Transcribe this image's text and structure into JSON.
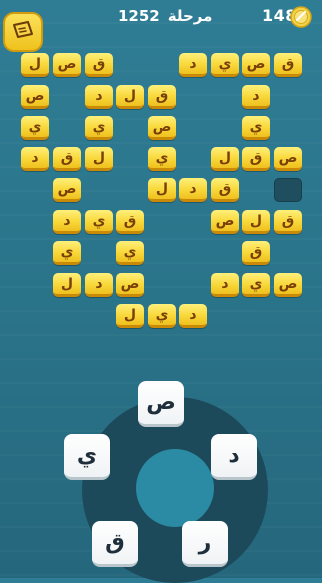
{
  "header": {
    "coins": "148",
    "level_label": "مرحلة",
    "level_number": "1252"
  },
  "icons": {
    "hint": "hint-ticket-icon",
    "coin": "coin-icon"
  },
  "colors": {
    "background": "#2a7389",
    "tile": "#f8d83a",
    "tile_text": "#7a3f08",
    "wheel_ring": "#1d4a5a",
    "wheel_center": "#2b8aa4",
    "key_bg": "#ffffff"
  },
  "board": {
    "rows": [
      [
        "ق",
        "ص",
        "ي",
        "د",
        "",
        "",
        "ق",
        "ص",
        "ل"
      ],
      [
        "د",
        "",
        "",
        "",
        "ق",
        "ل",
        "د",
        "",
        "ص"
      ],
      [
        "ي",
        "",
        "",
        "",
        "ص",
        "",
        "ي",
        "",
        "ي"
      ],
      [
        "ص",
        "ق",
        "ل",
        "",
        "ي",
        "",
        "ل",
        "ق",
        "د"
      ],
      [
        "",
        "",
        "ق",
        "د",
        "ل",
        "",
        "ص",
        "",
        ""
      ],
      [
        "ق",
        "ل",
        "ص",
        "",
        "",
        "ق",
        "ي",
        "د",
        ""
      ],
      [
        "",
        "ق",
        "",
        "",
        "ي",
        "",
        "",
        "ي",
        ""
      ],
      [
        "ص",
        "ي",
        "د",
        "",
        "ص",
        "د",
        "ل",
        "",
        ""
      ],
      [
        "",
        "",
        "",
        "د",
        "ي",
        "ل",
        "",
        "",
        ""
      ]
    ],
    "tiles": [
      {
        "ch": "ل"
      },
      {
        "ch": "ص"
      },
      {
        "ch": "ق"
      },
      {
        "ch": "د"
      },
      {
        "ch": "ي"
      },
      {
        "ch": "ص"
      },
      {
        "ch": "ق"
      },
      {
        "ch": "ص"
      },
      {
        "ch": "د"
      },
      {
        "ch": "ل"
      },
      {
        "ch": "ق"
      },
      {
        "ch": "د"
      },
      {
        "ch": "ي"
      },
      {
        "ch": "ي"
      },
      {
        "ch": "ص"
      },
      {
        "ch": "ي"
      },
      {
        "ch": "د"
      },
      {
        "ch": "ق"
      },
      {
        "ch": "ل"
      },
      {
        "ch": "ي"
      },
      {
        "ch": "ل"
      },
      {
        "ch": "ق"
      },
      {
        "ch": "ص"
      },
      {
        "ch": "ص"
      },
      {
        "ch": "ل"
      },
      {
        "ch": "د"
      },
      {
        "ch": "ق"
      },
      {
        "ch": "د"
      },
      {
        "ch": "ي"
      },
      {
        "ch": "ق"
      },
      {
        "ch": "ص"
      },
      {
        "ch": "ل"
      },
      {
        "ch": "ق"
      },
      {
        "ch": "ي"
      },
      {
        "ch": "ي"
      },
      {
        "ch": "ق"
      },
      {
        "ch": "ل"
      },
      {
        "ch": "د"
      },
      {
        "ch": "ص"
      },
      {
        "ch": "د"
      },
      {
        "ch": "ي"
      },
      {
        "ch": "ص"
      },
      {
        "ch": "ل"
      },
      {
        "ch": "ي"
      },
      {
        "ch": "د"
      }
    ]
  },
  "wheel": {
    "letters": [
      "ص",
      "د",
      "ر",
      "ق",
      "ي"
    ]
  }
}
